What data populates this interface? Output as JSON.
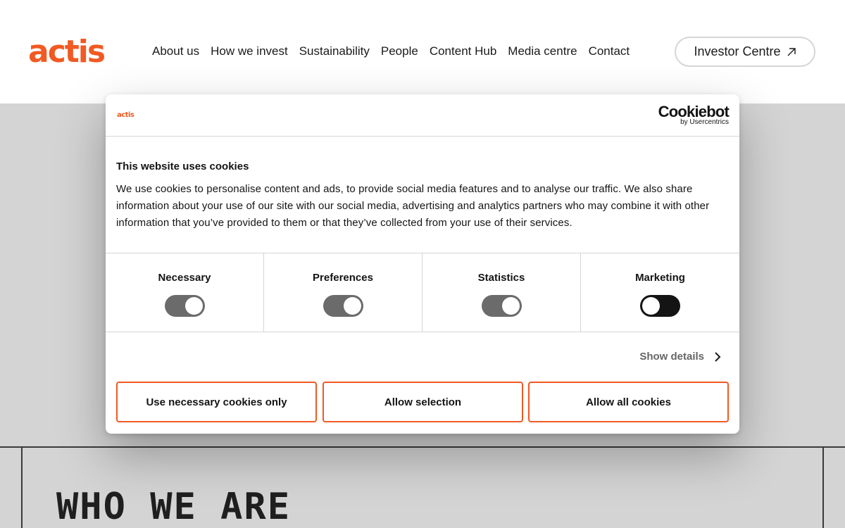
{
  "header": {
    "logo": "actis",
    "nav": [
      "About us",
      "How we invest",
      "Sustainability",
      "People",
      "Content Hub",
      "Media centre",
      "Contact"
    ],
    "investor_button": "Investor Centre",
    "icons": {
      "investor_arrow": "arrow-up-right-icon"
    }
  },
  "page": {
    "heading": "WHO WE ARE"
  },
  "cookie_dialog": {
    "logo": "actis",
    "brand": "Cookiebot",
    "brand_sub": "by Usercentrics",
    "title": "This website uses cookies",
    "body": "We use cookies to personalise content and ads, to provide social media features and to analyse our traffic. We also share information about your use of our site with our social media, advertising and analytics partners who may combine it with other information that you’ve provided to them or that they’ve collected from your use of their services.",
    "toggles": [
      {
        "label": "Necessary",
        "state": "on"
      },
      {
        "label": "Preferences",
        "state": "on"
      },
      {
        "label": "Statistics",
        "state": "on"
      },
      {
        "label": "Marketing",
        "state": "off"
      }
    ],
    "show_details": "Show details",
    "buttons": {
      "necessary_only": "Use necessary cookies only",
      "allow_selection": "Allow selection",
      "allow_all": "Allow all cookies"
    }
  },
  "colors": {
    "brand_orange": "#f15a22",
    "toggle_on": "#6b6b6b",
    "toggle_off": "#141414",
    "backdrop": "#d4d4d4"
  }
}
